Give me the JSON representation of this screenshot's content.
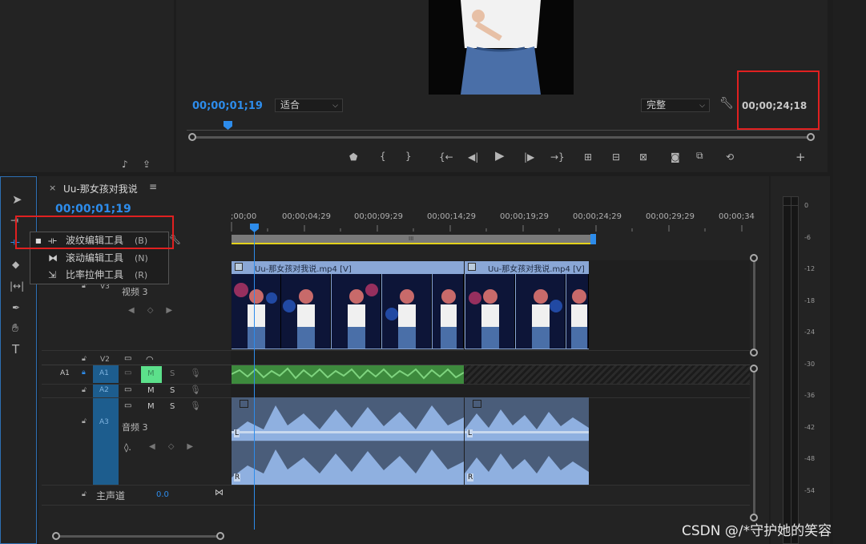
{
  "program_monitor": {
    "timecode_current": "00;00;01;19",
    "fit_select": "适合",
    "quality_select": "完整",
    "timecode_duration": "00;00;24;18"
  },
  "sequence": {
    "tab_close": "×",
    "tab_name": "Uu-那女孩对我说",
    "tab_menu": "≡",
    "timecode": "00;00;01;19",
    "ruler_labels": [
      ";00;00",
      "00;00;04;29",
      "00;00;09;29",
      "00;00;14;29",
      "00;00;19;29",
      "00;00;24;29",
      "00;00;29;29",
      "00;00;34"
    ]
  },
  "tool_menu": {
    "items": [
      {
        "label": "波纹编辑工具",
        "shortcut": "(B)",
        "selected": true
      },
      {
        "label": "滚动编辑工具",
        "shortcut": "(N)",
        "selected": false
      },
      {
        "label": "比率拉伸工具",
        "shortcut": "(R)",
        "selected": false
      }
    ]
  },
  "tracks": {
    "v3_label": "V3",
    "v3_name": "视频 3",
    "v2_label": "V2",
    "a1_source": "A1",
    "a1_label": "A1",
    "a2_label": "A2",
    "a3_label": "A3",
    "a3_name": "音频 3",
    "m": "M",
    "s": "S",
    "master_name": "主声道",
    "master_value": "0.0"
  },
  "clips": {
    "video1_name": "Uu-那女孩对我说.mp4 [V]",
    "video2_name": "Uu-那女孩对我说.mp4 [V]",
    "audio_l": "L",
    "audio_r": "R",
    "work_area_marker": "III"
  },
  "meter": {
    "labels": [
      "0",
      "-6",
      "-12",
      "-18",
      "-24",
      "-30",
      "-36",
      "-42",
      "-48",
      "-54"
    ]
  },
  "watermark": "CSDN @/*守护她的笑容",
  "colors": {
    "accent_blue": "#2d8ceb",
    "clip_video": "#8aa7d6",
    "clip_audio": "#7f9fd2",
    "clip_green": "#3d8a3d",
    "highlight_red": "#e02020",
    "mute_green": "#5ce08b"
  }
}
